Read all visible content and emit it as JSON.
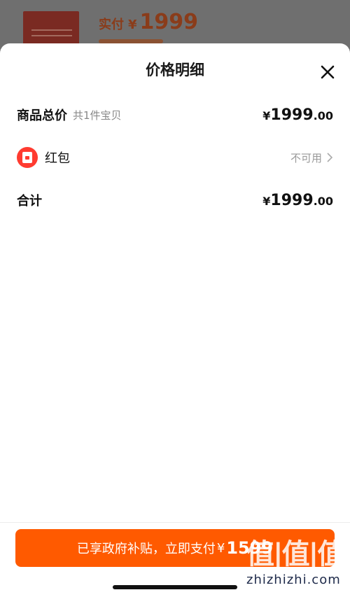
{
  "background": {
    "price_label": "实付",
    "currency": "¥",
    "price_value": "1999"
  },
  "sheet": {
    "title": "价格明细",
    "close_icon": "close-icon"
  },
  "rows": {
    "subtotal": {
      "label": "商品总价",
      "note": "共1件宝贝",
      "currency": "¥",
      "integer": "1999",
      "decimal": ".00"
    },
    "red_packet": {
      "label": "红包",
      "status": "不可用",
      "icon": "red-packet-icon"
    },
    "total": {
      "label": "合计",
      "currency": "¥",
      "integer": "1999",
      "decimal": ".00"
    }
  },
  "footer": {
    "button_text": "已享政府补贴，立即支付",
    "currency": "¥",
    "amount": "1599"
  },
  "watermark": {
    "logo": "值|值|值",
    "site": "zhizhizhi.com"
  },
  "colors": {
    "accent": "#ff5a00",
    "red_packet": "#ff3b30"
  }
}
